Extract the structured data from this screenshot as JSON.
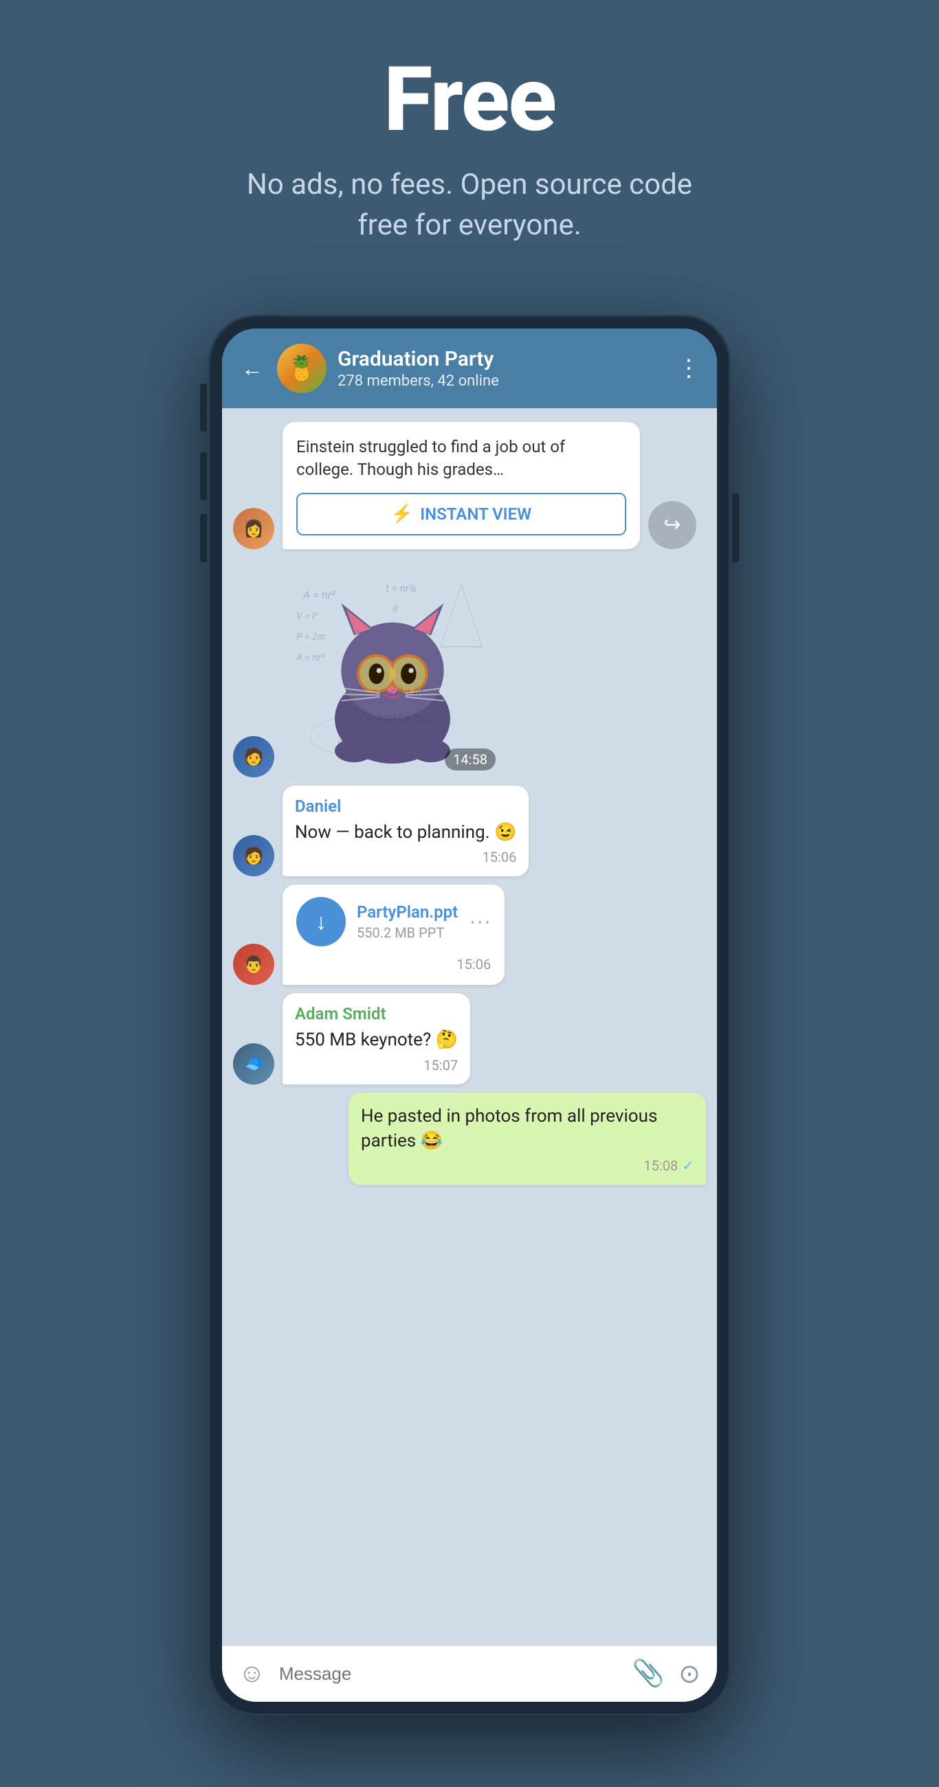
{
  "hero": {
    "title": "Free",
    "subtitle": "No ads, no fees. Open source code free for everyone."
  },
  "header": {
    "group_name": "Graduation Party",
    "group_meta": "278 members, 42 online",
    "back_label": "←",
    "more_label": "⋮"
  },
  "iv_card": {
    "text": "Einstein struggled to find a job out of college. Though his grades…",
    "btn_icon": "⚡",
    "btn_label": "INSTANT VIEW"
  },
  "sticker": {
    "time": "14:58"
  },
  "messages": [
    {
      "sender": "Daniel",
      "text": "Now — back to planning. 😉",
      "time": "15:06",
      "own": false
    },
    {
      "sender": "",
      "file_name": "PartyPlan.ppt",
      "file_meta": "550.2 MB PPT",
      "time": "15:06",
      "own": false,
      "is_file": true
    },
    {
      "sender": "Adam Smidt",
      "text": "550 MB keynote? 🤔",
      "time": "15:07",
      "own": false
    },
    {
      "sender": "",
      "text": "He pasted in photos from all previous parties 😂",
      "time": "15:08",
      "own": true
    }
  ],
  "input_bar": {
    "placeholder": "Message",
    "emoji_icon": "☺",
    "attach_icon": "📎",
    "camera_icon": "⊙"
  },
  "colors": {
    "bg": "#3d5a73",
    "header": "#4a7fa5",
    "chat_bg": "#c8d8e8",
    "own_bubble": "#d9f5b2",
    "other_bubble": "#ffffff"
  }
}
